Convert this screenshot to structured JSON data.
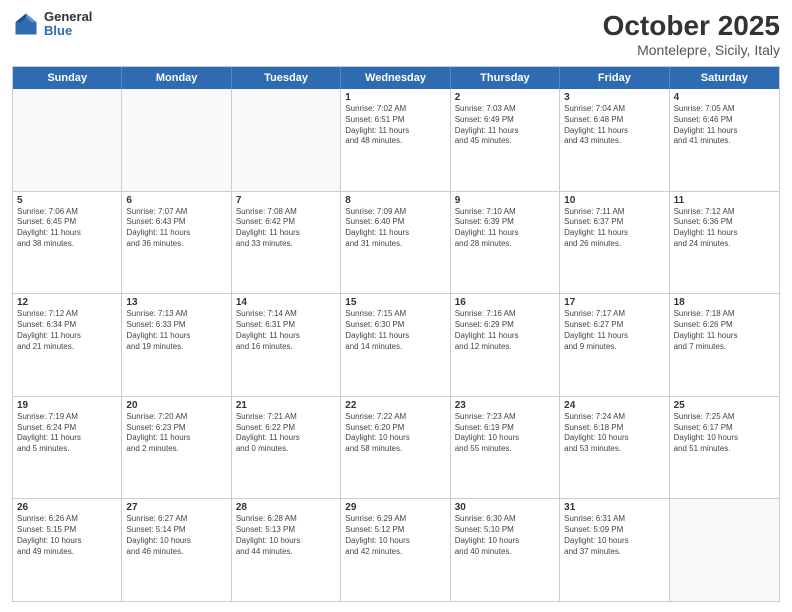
{
  "logo": {
    "general": "General",
    "blue": "Blue"
  },
  "header": {
    "month": "October 2025",
    "location": "Montelepre, Sicily, Italy"
  },
  "day_headers": [
    "Sunday",
    "Monday",
    "Tuesday",
    "Wednesday",
    "Thursday",
    "Friday",
    "Saturday"
  ],
  "weeks": [
    [
      {
        "date": "",
        "info": ""
      },
      {
        "date": "",
        "info": ""
      },
      {
        "date": "",
        "info": ""
      },
      {
        "date": "1",
        "info": "Sunrise: 7:02 AM\nSunset: 6:51 PM\nDaylight: 11 hours\nand 48 minutes."
      },
      {
        "date": "2",
        "info": "Sunrise: 7:03 AM\nSunset: 6:49 PM\nDaylight: 11 hours\nand 45 minutes."
      },
      {
        "date": "3",
        "info": "Sunrise: 7:04 AM\nSunset: 6:48 PM\nDaylight: 11 hours\nand 43 minutes."
      },
      {
        "date": "4",
        "info": "Sunrise: 7:05 AM\nSunset: 6:46 PM\nDaylight: 11 hours\nand 41 minutes."
      }
    ],
    [
      {
        "date": "5",
        "info": "Sunrise: 7:06 AM\nSunset: 6:45 PM\nDaylight: 11 hours\nand 38 minutes."
      },
      {
        "date": "6",
        "info": "Sunrise: 7:07 AM\nSunset: 6:43 PM\nDaylight: 11 hours\nand 36 minutes."
      },
      {
        "date": "7",
        "info": "Sunrise: 7:08 AM\nSunset: 6:42 PM\nDaylight: 11 hours\nand 33 minutes."
      },
      {
        "date": "8",
        "info": "Sunrise: 7:09 AM\nSunset: 6:40 PM\nDaylight: 11 hours\nand 31 minutes."
      },
      {
        "date": "9",
        "info": "Sunrise: 7:10 AM\nSunset: 6:39 PM\nDaylight: 11 hours\nand 28 minutes."
      },
      {
        "date": "10",
        "info": "Sunrise: 7:11 AM\nSunset: 6:37 PM\nDaylight: 11 hours\nand 26 minutes."
      },
      {
        "date": "11",
        "info": "Sunrise: 7:12 AM\nSunset: 6:36 PM\nDaylight: 11 hours\nand 24 minutes."
      }
    ],
    [
      {
        "date": "12",
        "info": "Sunrise: 7:12 AM\nSunset: 6:34 PM\nDaylight: 11 hours\nand 21 minutes."
      },
      {
        "date": "13",
        "info": "Sunrise: 7:13 AM\nSunset: 6:33 PM\nDaylight: 11 hours\nand 19 minutes."
      },
      {
        "date": "14",
        "info": "Sunrise: 7:14 AM\nSunset: 6:31 PM\nDaylight: 11 hours\nand 16 minutes."
      },
      {
        "date": "15",
        "info": "Sunrise: 7:15 AM\nSunset: 6:30 PM\nDaylight: 11 hours\nand 14 minutes."
      },
      {
        "date": "16",
        "info": "Sunrise: 7:16 AM\nSunset: 6:29 PM\nDaylight: 11 hours\nand 12 minutes."
      },
      {
        "date": "17",
        "info": "Sunrise: 7:17 AM\nSunset: 6:27 PM\nDaylight: 11 hours\nand 9 minutes."
      },
      {
        "date": "18",
        "info": "Sunrise: 7:18 AM\nSunset: 6:26 PM\nDaylight: 11 hours\nand 7 minutes."
      }
    ],
    [
      {
        "date": "19",
        "info": "Sunrise: 7:19 AM\nSunset: 6:24 PM\nDaylight: 11 hours\nand 5 minutes."
      },
      {
        "date": "20",
        "info": "Sunrise: 7:20 AM\nSunset: 6:23 PM\nDaylight: 11 hours\nand 2 minutes."
      },
      {
        "date": "21",
        "info": "Sunrise: 7:21 AM\nSunset: 6:22 PM\nDaylight: 11 hours\nand 0 minutes."
      },
      {
        "date": "22",
        "info": "Sunrise: 7:22 AM\nSunset: 6:20 PM\nDaylight: 10 hours\nand 58 minutes."
      },
      {
        "date": "23",
        "info": "Sunrise: 7:23 AM\nSunset: 6:19 PM\nDaylight: 10 hours\nand 55 minutes."
      },
      {
        "date": "24",
        "info": "Sunrise: 7:24 AM\nSunset: 6:18 PM\nDaylight: 10 hours\nand 53 minutes."
      },
      {
        "date": "25",
        "info": "Sunrise: 7:25 AM\nSunset: 6:17 PM\nDaylight: 10 hours\nand 51 minutes."
      }
    ],
    [
      {
        "date": "26",
        "info": "Sunrise: 6:26 AM\nSunset: 5:15 PM\nDaylight: 10 hours\nand 49 minutes."
      },
      {
        "date": "27",
        "info": "Sunrise: 6:27 AM\nSunset: 5:14 PM\nDaylight: 10 hours\nand 46 minutes."
      },
      {
        "date": "28",
        "info": "Sunrise: 6:28 AM\nSunset: 5:13 PM\nDaylight: 10 hours\nand 44 minutes."
      },
      {
        "date": "29",
        "info": "Sunrise: 6:29 AM\nSunset: 5:12 PM\nDaylight: 10 hours\nand 42 minutes."
      },
      {
        "date": "30",
        "info": "Sunrise: 6:30 AM\nSunset: 5:10 PM\nDaylight: 10 hours\nand 40 minutes."
      },
      {
        "date": "31",
        "info": "Sunrise: 6:31 AM\nSunset: 5:09 PM\nDaylight: 10 hours\nand 37 minutes."
      },
      {
        "date": "",
        "info": ""
      }
    ]
  ]
}
